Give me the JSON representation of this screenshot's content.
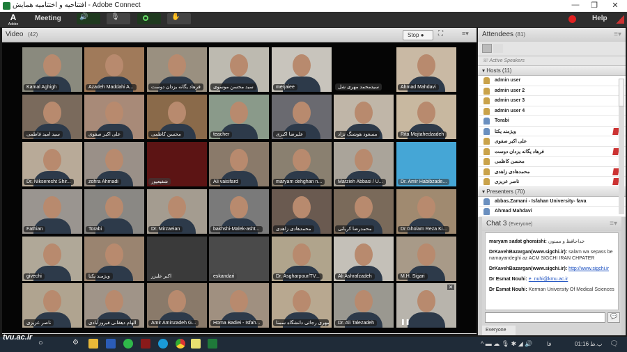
{
  "window": {
    "title": "افتتاحیه و اختتامیه همایش - Adobe Connect",
    "minimize": "—",
    "restore": "❐",
    "close": "✕"
  },
  "menubar": {
    "logo": "Adobe",
    "meeting": "Meeting",
    "help": "Help",
    "record_color": "#e02020"
  },
  "video": {
    "title": "Video",
    "count": "(42)",
    "stop_label": "Stop",
    "tiles": [
      {
        "name": "Kamal Aghigh",
        "bg": "#8a8a7e"
      },
      {
        "name": "Azadeh Maddahi A...",
        "bg": "#a07a5a"
      },
      {
        "name": "فرهاد یگانه یزدان دوست",
        "bg": "#9a9080"
      },
      {
        "name": "سید محسن موسوی",
        "bg": "#bdbab0"
      },
      {
        "name": "merjaiee",
        "bg": "#c8c4bc"
      },
      {
        "name": "سیدمحمد مهری شل",
        "bg": "#050505",
        "empty": true
      },
      {
        "name": "Ahmad Mahdavi",
        "bg": "#c9b9a4"
      },
      {
        "name": "سید امید فاطمی",
        "bg": "#7a6a5c"
      },
      {
        "name": "علی اکبر صفوی",
        "bg": "#a88a78"
      },
      {
        "name": "محسن کاظمی",
        "bg": "#8a6a4a"
      },
      {
        "name": "teacher",
        "bg": "#8a9a8a"
      },
      {
        "name": "علیرضا اکبری",
        "bg": "#6a6a70"
      },
      {
        "name": "مسعود هوشنگ نژاد",
        "bg": "#c0b6a8"
      },
      {
        "name": "Rita Mojtahedzadeh",
        "bg": "#c8b8a0"
      },
      {
        "name": "Dr. Nikseresht Shir...",
        "bg": "#b8aa98"
      },
      {
        "name": "zohra Ahmadi",
        "bg": "#9a9088"
      },
      {
        "name": "شفیعپور",
        "bg": "#5c1414",
        "empty": true
      },
      {
        "name": "Ali vaisifard",
        "bg": "#8a7a6a"
      },
      {
        "name": "maryam dehghan n...",
        "bg": "#8a8070"
      },
      {
        "name": "Marzieh Abbasi / U...",
        "bg": "#aaa49a"
      },
      {
        "name": "Dr. Amir Habibzade...",
        "bg": "#45a6d6",
        "empty": true
      },
      {
        "name": "Fathian",
        "bg": "#9a9590"
      },
      {
        "name": "Torabi",
        "bg": "#8a8884"
      },
      {
        "name": "Dr. Mirzaeian",
        "bg": "#a49c90"
      },
      {
        "name": "bakhshi-Malek-asht...",
        "bg": "#7a7a7a"
      },
      {
        "name": "محمدهادی زاهدی",
        "bg": "#6a5a50"
      },
      {
        "name": "محمدرضا کریاتی",
        "bg": "#7a6a5a"
      },
      {
        "name": "Dr Gholam Reza Ki...",
        "bg": "#a08a70"
      },
      {
        "name": "givechi",
        "bg": "#b0a898"
      },
      {
        "name": "ویژمند یکتا",
        "bg": "#9a8470"
      },
      {
        "name": "اکبر علیزر",
        "bg": "#3a3a3a",
        "empty": true
      },
      {
        "name": "eskandari",
        "bg": "#4a4a4a",
        "empty": true
      },
      {
        "name": "Dr. Asgharpour/TV...",
        "bg": "#b0a48c"
      },
      {
        "name": "Ali Ashrafzadeh",
        "bg": "#c4c0b8"
      },
      {
        "name": "M.H. Sigari",
        "bg": "#a89a88"
      },
      {
        "name": "ناصر عزیزی",
        "bg": "#b0a490"
      },
      {
        "name": "الهام دهقانی فیروزآبادی",
        "bg": "#a09488"
      },
      {
        "name": "Amir Aminzadeh G...",
        "bg": "#8a7a6a"
      },
      {
        "name": "Homa Badiei - Isfah...",
        "bg": "#a09080"
      },
      {
        "name": "مهری رجائی دانشگاه سمنا",
        "bg": "#b8a890"
      },
      {
        "name": "Dr. Ali Talezadeh",
        "bg": "#9a9890"
      },
      {
        "name": "",
        "bg": "#b8b4ac",
        "paused": true
      }
    ]
  },
  "attendees": {
    "title": "Attendees",
    "count": "(81)",
    "active_speakers": "Active Speakers",
    "hosts_label": "Hosts (11)",
    "hosts": [
      {
        "name": "admin user"
      },
      {
        "name": "admin user 2"
      },
      {
        "name": "admin user 3"
      },
      {
        "name": "admin user 4"
      },
      {
        "name": "Torabi",
        "blue": true
      },
      {
        "name": "ویژمند یکتا",
        "blue": true,
        "mic": true
      },
      {
        "name": "علی اکبر صفوی"
      },
      {
        "name": "فرهاد یگانه یزدان دوست",
        "mic": true
      },
      {
        "name": "محسن کاظمی"
      },
      {
        "name": "محمدهادی زاهدی",
        "mic": true
      },
      {
        "name": "ناصر عزیزی",
        "mic": true
      }
    ],
    "presenters_label": "Presenters (70)",
    "presenters": [
      {
        "name": "abbas.Zamani - Isfahan University- fava"
      },
      {
        "name": "Ahmad Mahdavi"
      }
    ]
  },
  "chat": {
    "title": "Chat 3",
    "scope": "(Everyone)",
    "tab": "Everyone",
    "messages": [
      {
        "sender": "maryam sadat ghoraishi:",
        "text": " خداحافظ و ممنون"
      },
      {
        "sender": "DrKavehBazargan(www.sigchi.ir):",
        "text": " salam wa sepass be namayandeghi az ACM SIGCHI IRAN CHPATER"
      },
      {
        "sender": "DrKavehBazargan(www.sigchi.ir):",
        "link": "http://www.sigchi.ir"
      },
      {
        "sender": "Dr Esmat Nouhi:",
        "link": "e_nuhi@kmu.ac.ir"
      },
      {
        "sender": "Dr Esmat Nouhi:",
        "text": " Kerman University Of Medical Sciences"
      }
    ]
  },
  "taskbar": {
    "watermark": "tvu.ac.ir",
    "lang": "فا",
    "time": "01:16 ب.ظ"
  }
}
